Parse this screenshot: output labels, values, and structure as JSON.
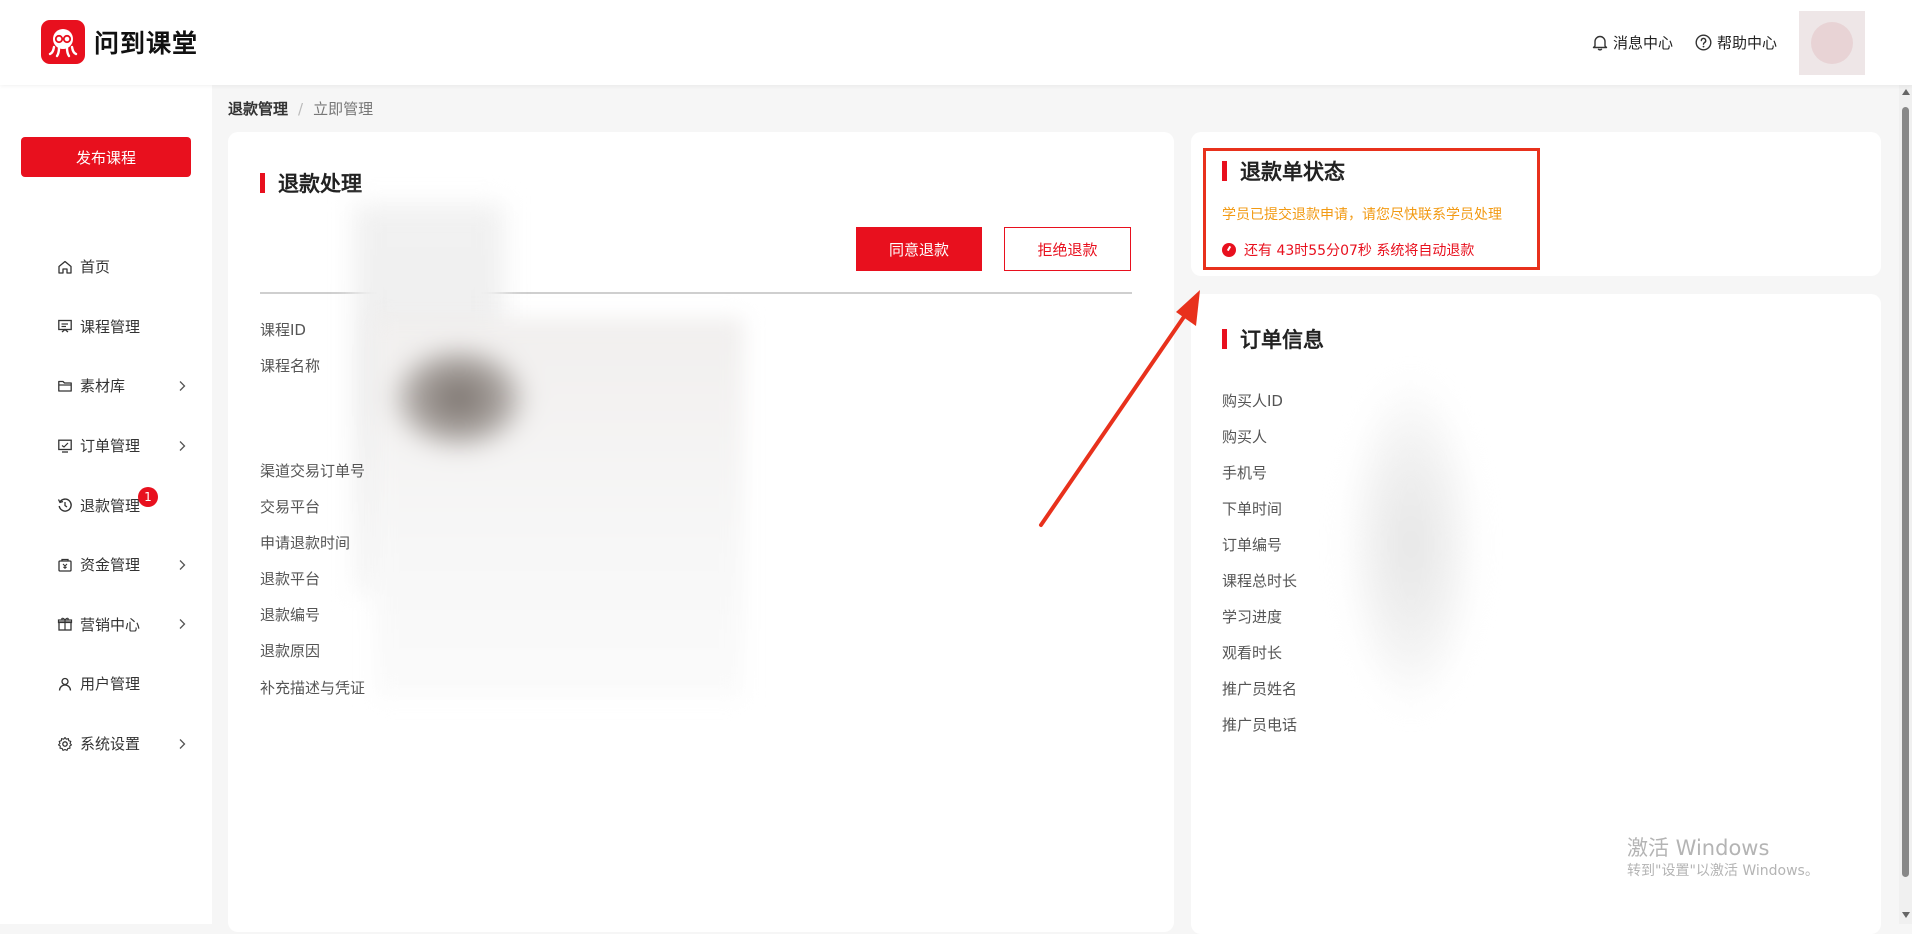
{
  "header": {
    "logo_text": "问到课堂",
    "messages_label": "消息中心",
    "help_label": "帮助中心"
  },
  "sidebar": {
    "publish_label": "发布课程",
    "items": [
      {
        "label": "首页",
        "icon": "home-icon",
        "has_chevron": false
      },
      {
        "label": "课程管理",
        "icon": "course-icon",
        "has_chevron": false
      },
      {
        "label": "素材库",
        "icon": "folder-icon",
        "has_chevron": true
      },
      {
        "label": "订单管理",
        "icon": "order-icon",
        "has_chevron": true
      },
      {
        "label": "退款管理",
        "icon": "refund-icon",
        "has_chevron": false,
        "badge": "1"
      },
      {
        "label": "资金管理",
        "icon": "wallet-icon",
        "has_chevron": true
      },
      {
        "label": "营销中心",
        "icon": "gift-icon",
        "has_chevron": true
      },
      {
        "label": "用户管理",
        "icon": "user-icon",
        "has_chevron": false
      },
      {
        "label": "系统设置",
        "icon": "gear-icon",
        "has_chevron": true
      }
    ]
  },
  "breadcrumb": {
    "first": "退款管理",
    "separator": "/",
    "current": "立即管理"
  },
  "refund": {
    "title": "退款处理",
    "agree_label": "同意退款",
    "reject_label": "拒绝退款",
    "fields": [
      "课程ID",
      "课程名称",
      "渠道交易订单号",
      "交易平台",
      "申请退款时间",
      "退款平台",
      "退款编号",
      "退款原因",
      "补充描述与凭证"
    ]
  },
  "status": {
    "title": "退款单状态",
    "warning": "学员已提交退款申请，请您尽快联系学员处理",
    "timer": "还有 43时55分07秒 系统将自动退款"
  },
  "order": {
    "title": "订单信息",
    "fields": [
      "购买人ID",
      "购买人",
      "手机号",
      "下单时间",
      "订单编号",
      "课程总时长",
      "学习进度",
      "观看时长",
      "推广员姓名",
      "推广员电话"
    ]
  },
  "watermark": {
    "line1": "激活 Windows",
    "line2": "转到\"设置\"以激活 Windows。"
  },
  "colors": {
    "brand": "#e8101e",
    "warning": "#f29a13",
    "annotation": "#e8311c"
  }
}
